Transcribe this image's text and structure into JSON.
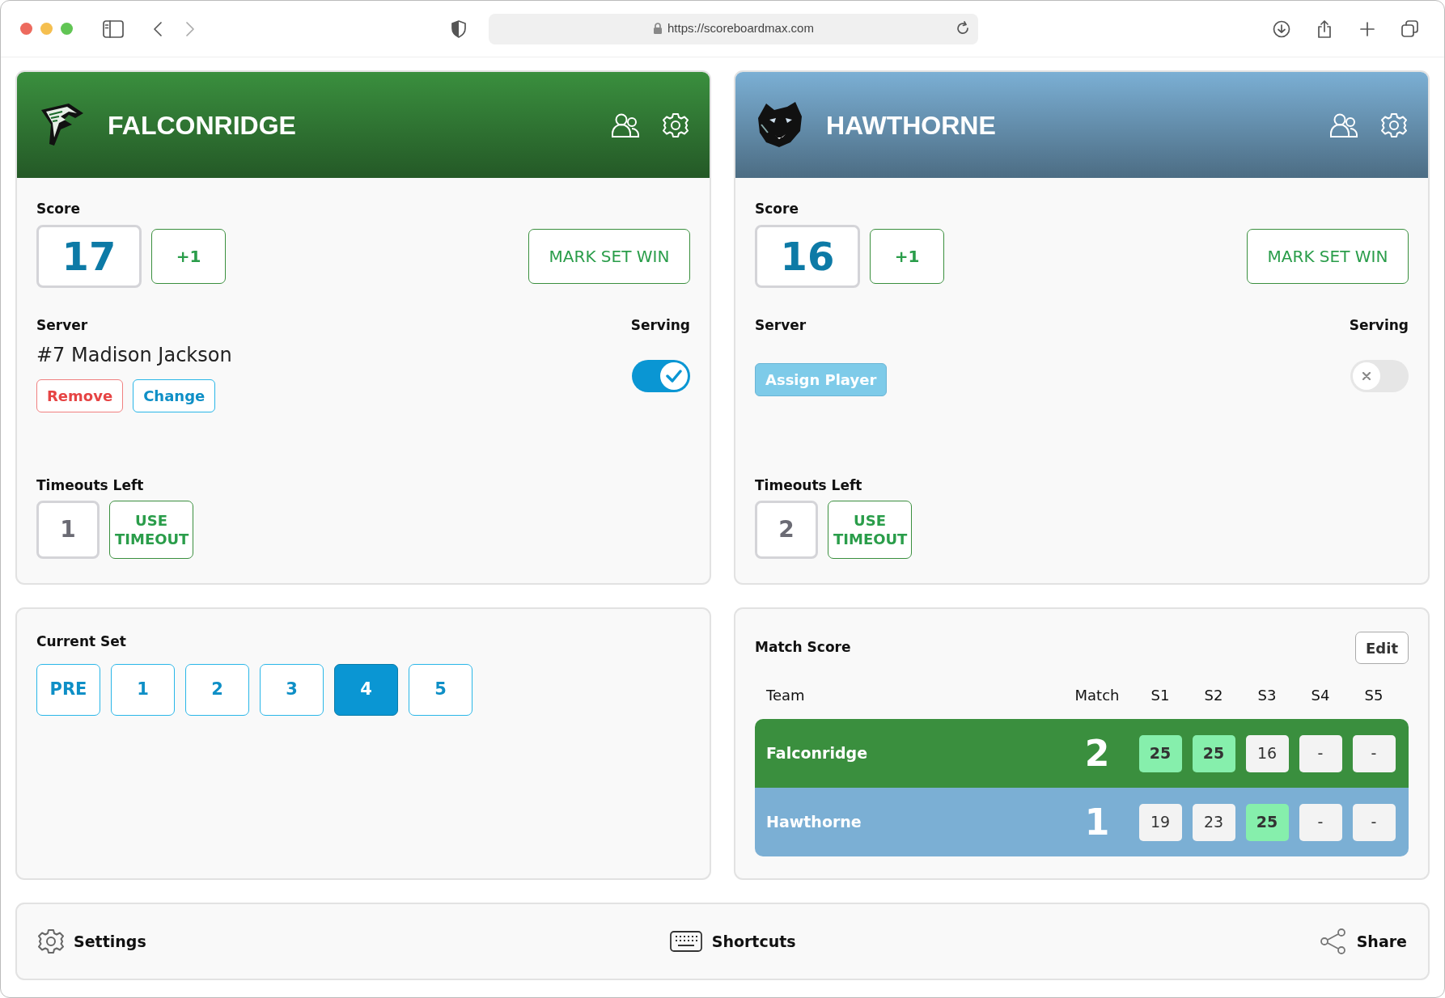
{
  "browser": {
    "url": "https://scoreboardmax.com"
  },
  "teams": [
    {
      "name": "FALCONRIDGE",
      "logo": {
        "kind": "bird"
      },
      "color": "#3a8f3e",
      "score_label": "Score",
      "score": "17",
      "increment": "+1",
      "mark_win": "MARK SET WIN",
      "server_label": "Server",
      "serving_label": "Serving",
      "serving": true,
      "server": {
        "kind": "assigned",
        "player": "#7 Madison Jackson",
        "remove": "Remove",
        "change": "Change"
      },
      "timeouts_label": "Timeouts Left",
      "timeouts": "1",
      "use_timeout": "USE TIMEOUT"
    },
    {
      "name": "HAWTHORNE",
      "logo": {
        "kind": "cat"
      },
      "color": "#7bafd4",
      "score_label": "Score",
      "score": "16",
      "increment": "+1",
      "mark_win": "MARK SET WIN",
      "server_label": "Server",
      "serving_label": "Serving",
      "serving": false,
      "server": {
        "kind": "empty",
        "assign": "Assign Player"
      },
      "timeouts_label": "Timeouts Left",
      "timeouts": "2",
      "use_timeout": "USE TIMEOUT"
    }
  ],
  "current_set": {
    "label": "Current Set",
    "sets": [
      {
        "label": "PRE",
        "selected": false
      },
      {
        "label": "1",
        "selected": false
      },
      {
        "label": "2",
        "selected": false
      },
      {
        "label": "3",
        "selected": false
      },
      {
        "label": "4",
        "selected": true
      },
      {
        "label": "5",
        "selected": false
      }
    ]
  },
  "match_score": {
    "title": "Match Score",
    "edit": "Edit",
    "columns": [
      "Team",
      "Match",
      "S1",
      "S2",
      "S3",
      "S4",
      "S5"
    ],
    "rows": [
      {
        "team": "Falconridge",
        "color": "#3a8f3e",
        "match": "2",
        "sets": [
          {
            "value": "25",
            "won": true
          },
          {
            "value": "25",
            "won": true
          },
          {
            "value": "16",
            "won": false
          },
          {
            "value": "-",
            "won": false
          },
          {
            "value": "-",
            "won": false
          }
        ]
      },
      {
        "team": "Hawthorne",
        "color": "#7bafd4",
        "match": "1",
        "sets": [
          {
            "value": "19",
            "won": false
          },
          {
            "value": "23",
            "won": false
          },
          {
            "value": "25",
            "won": true
          },
          {
            "value": "-",
            "won": false
          },
          {
            "value": "-",
            "won": false
          }
        ]
      }
    ]
  },
  "footer": [
    {
      "kind": "settings",
      "label": "Settings"
    },
    {
      "kind": "keyboard",
      "label": "Shortcuts"
    },
    {
      "kind": "share",
      "label": "Share"
    }
  ]
}
